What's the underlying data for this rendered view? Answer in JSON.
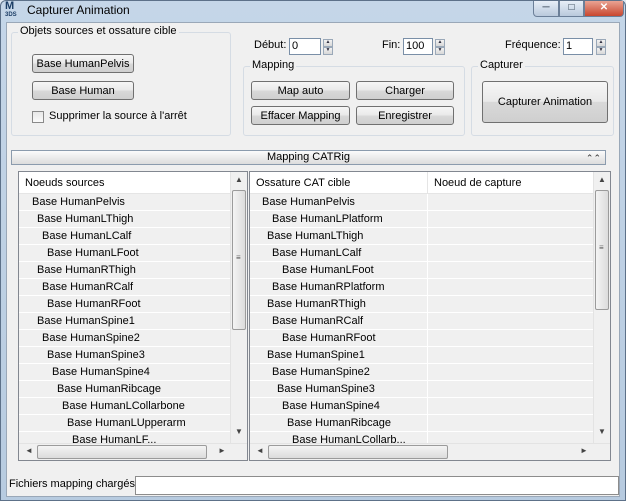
{
  "window": {
    "title": "Capturer Animation",
    "icon": {
      "top": "M",
      "bottom": "3DS"
    },
    "controls": {
      "minimize": "─",
      "maximize": "□",
      "close": "✕"
    }
  },
  "source_group": {
    "title": "Objets sources et ossature cible",
    "btn_pelvis": "Base HumanPelvis",
    "btn_human": "Base Human",
    "checkbox_label": "Supprimer la source à l'arrêt"
  },
  "timing": {
    "start_label": "Début:",
    "start_value": "0",
    "end_label": "Fin:",
    "end_value": "100",
    "freq_label": "Fréquence:",
    "freq_value": "1"
  },
  "mapping_group": {
    "title": "Mapping",
    "btn_map_auto": "Map auto",
    "btn_load": "Charger",
    "btn_clear": "Effacer Mapping",
    "btn_save": "Enregistrer"
  },
  "capture_group": {
    "title": "Capturer",
    "btn_capture": "Capturer Animation"
  },
  "rollout": {
    "title": "Mapping CATRig",
    "icon": "⌃⌃"
  },
  "source_nodes": {
    "header": "Noeuds sources",
    "items": [
      "Base HumanPelvis",
      "Base HumanLThigh",
      "Base HumanLCalf",
      "Base HumanLFoot",
      "Base HumanRThigh",
      "Base HumanRCalf",
      "Base HumanRFoot",
      "Base HumanSpine1",
      "Base HumanSpine2",
      "Base HumanSpine3",
      "Base HumanSpine4",
      "Base HumanRibcage",
      "Base HumanLCollarbone",
      "Base HumanLUpperarm",
      "Base HumanLF..."
    ]
  },
  "target_nodes": {
    "header_1": "Ossature CAT cible",
    "header_2": "Noeud de capture",
    "items": [
      "Base HumanPelvis",
      "Base HumanLPlatform",
      "Base HumanLThigh",
      "Base HumanLCalf",
      "Base HumanLFoot",
      "Base HumanRPlatform",
      "Base HumanRThigh",
      "Base HumanRCalf",
      "Base HumanRFoot",
      "Base HumanSpine1",
      "Base HumanSpine2",
      "Base HumanSpine3",
      "Base HumanSpine4",
      "Base HumanRibcage",
      "Base HumanLCollarb..."
    ]
  },
  "scroll": {
    "up": "▲",
    "down": "▼",
    "left": "◄",
    "right": "►",
    "grip": "≡",
    "hgrip": "|||"
  },
  "status": {
    "label": "Fichiers mapping chargés"
  }
}
